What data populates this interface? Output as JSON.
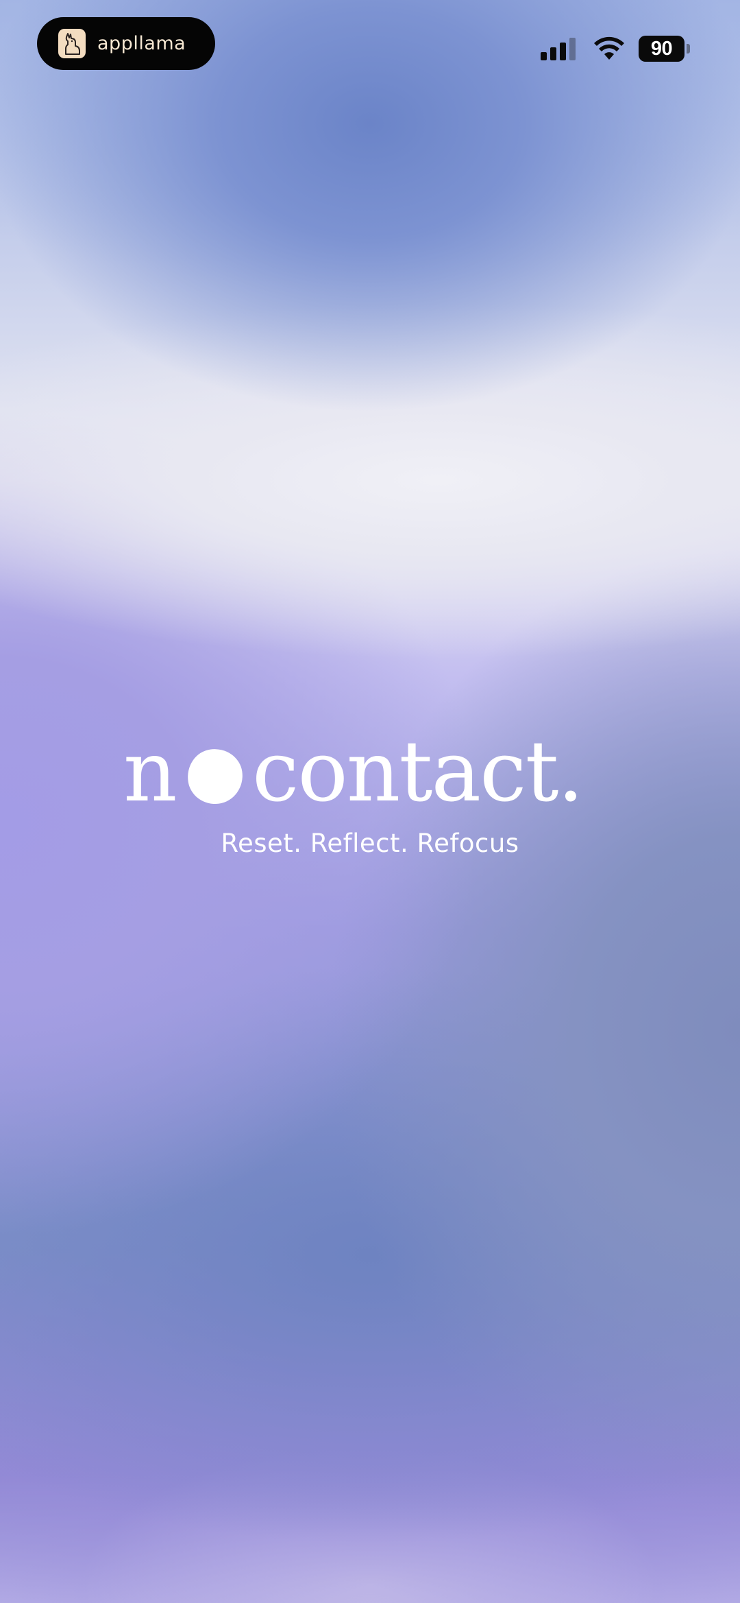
{
  "status_bar": {
    "app_activity_label": "appllama",
    "app_icon": "llama-icon",
    "signal_icon": "cellular-signal-icon",
    "wifi_icon": "wifi-icon",
    "battery_level": "90"
  },
  "splash": {
    "logo_first": "n",
    "logo_rest": "contact.",
    "tagline": "Reset. Reflect. Refocus"
  },
  "colors": {
    "logo_text": "#ffffff",
    "island_bg": "#050505",
    "island_text": "#f6e7d2",
    "app_icon_bg": "#f3dcc0",
    "accent_blue": "#6b84c8",
    "accent_purple": "#a39ce6"
  }
}
